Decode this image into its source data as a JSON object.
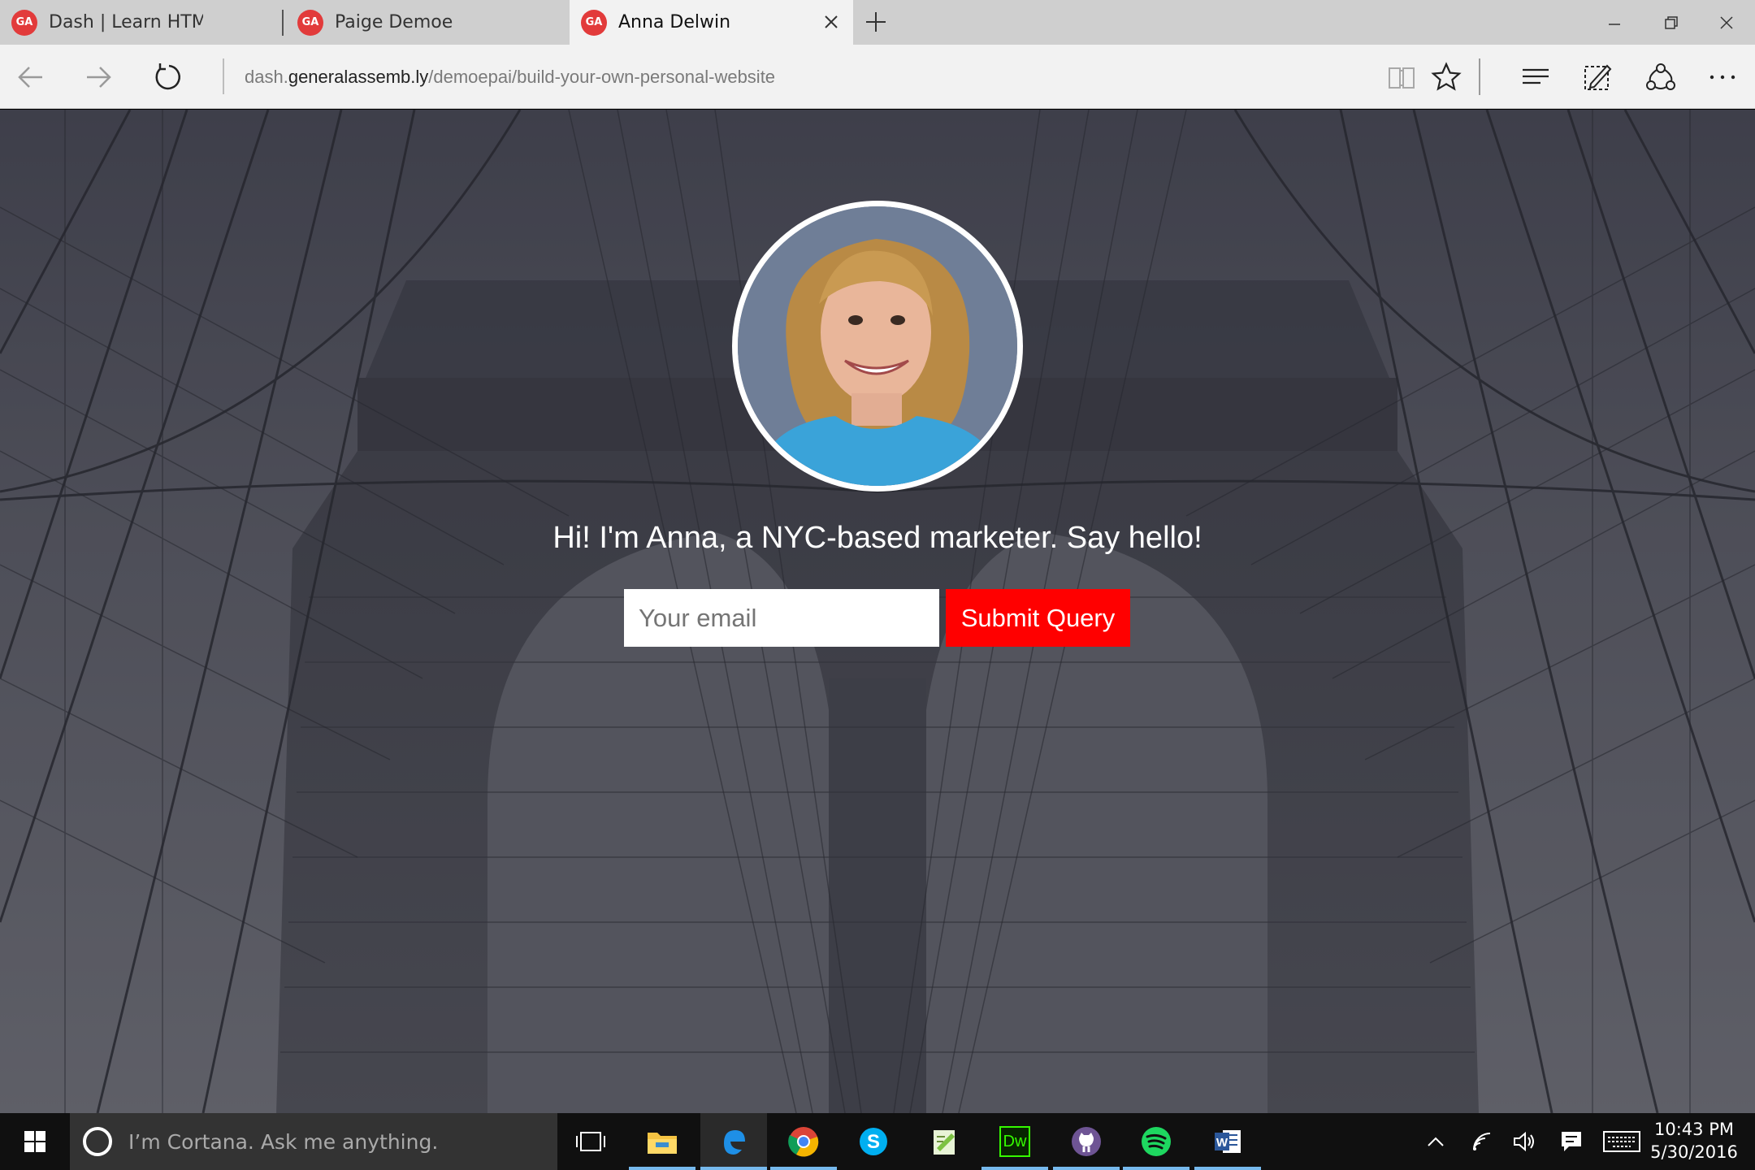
{
  "browser": {
    "tabs": [
      {
        "label": "Dash | Learn HTML, CSS, Jav",
        "icon": "ga-logo-icon",
        "active": false
      },
      {
        "label": "Paige Demoe",
        "icon": "ga-logo-icon",
        "active": false
      },
      {
        "label": "Anna Delwin",
        "icon": "ga-logo-icon",
        "active": true
      }
    ],
    "favicon_text": "GA",
    "url_prefix": "dash.",
    "url_domain": "generalassemb.ly",
    "url_path": "/demoepai/build-your-own-personal-website"
  },
  "page": {
    "headline": "Hi! I'm Anna, a NYC-based marketer. Say hello!",
    "email_placeholder": "Your email",
    "submit_label": "Submit Query",
    "accent_color": "#ff0000"
  },
  "taskbar": {
    "cortana_placeholder": "I’m Cortana. Ask me anything.",
    "apps": [
      "task-view",
      "file-explorer",
      "edge",
      "chrome",
      "skype",
      "notepad-plus",
      "dreamweaver",
      "github",
      "spotify",
      "word"
    ],
    "dw_label": "Dw",
    "time": "10:43 PM",
    "date": "5/30/2016"
  }
}
